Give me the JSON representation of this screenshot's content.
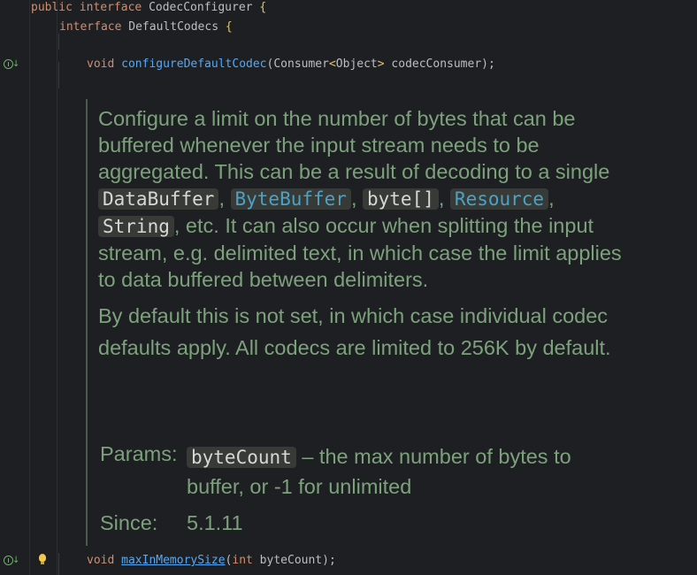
{
  "code": {
    "line1": {
      "kw1": "public",
      "kw2": "interface",
      "name": "CodecConfigurer",
      "brace": "{"
    },
    "line2": {
      "kw": "interface",
      "name": "DefaultCodecs",
      "brace": "{"
    },
    "line3": {
      "kw": "void",
      "method": "configureDefaultCodec",
      "open": "(",
      "type": "Consumer",
      "lt": "<",
      "generic": "Object",
      "gt": ">",
      "param": " codecConsumer",
      "close": ");"
    },
    "line4": {
      "kw": "void",
      "method": "maxInMemorySize",
      "open": "(",
      "ptype": "int",
      "param": " byteCount",
      "close": ");"
    }
  },
  "doc": {
    "p1_a": "Configure a limit on the number of bytes that can be buffered whenever the input stream needs to be aggregated. This can be a result of decoding to a single ",
    "chip1": "DataBuffer",
    "sep1": ", ",
    "chip2": "ByteBuffer",
    "sep2": ", ",
    "chip3": "byte[]",
    "sep3": ", ",
    "chip4": "Resource",
    "sep4": ", ",
    "chip5": "String",
    "p1_b": ", etc. It can also occur when splitting the input stream, e.g. delimited text, in which case the limit applies to data buffered between delimiters.",
    "p2": "By default this is not set, in which case individual codec defaults apply. All codecs are limited to 256K by default.",
    "params_label": "Params:",
    "param_name": "byteCount",
    "param_desc": " – the max number of bytes to buffer, or -1 for unlimited",
    "since_label": "Since:",
    "since_value": "5.1.11"
  },
  "gutter": {
    "icons": [
      "implemented-method-icon",
      "implemented-method-icon"
    ],
    "intention": "lightbulb-icon"
  }
}
